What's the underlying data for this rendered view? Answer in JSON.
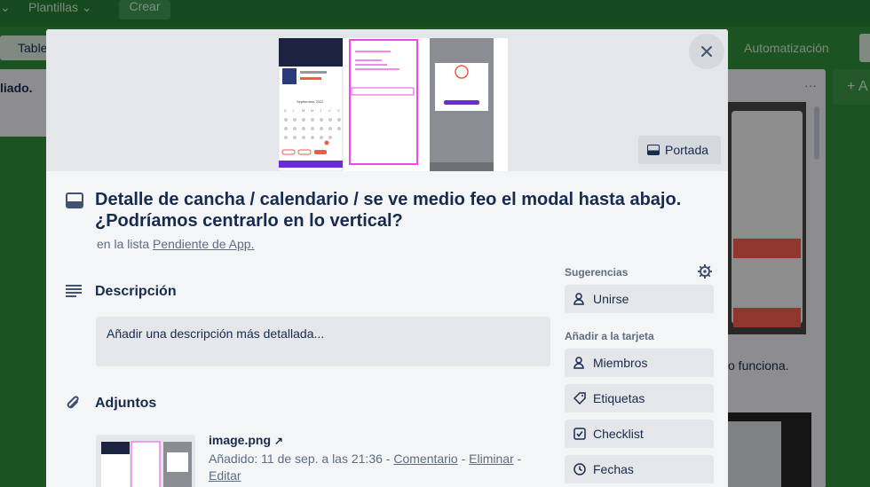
{
  "board": {
    "menu_partial": "⌄",
    "menu_templates": "Plantillas",
    "create_label": "Crear",
    "view_table": "Table",
    "automation_label": "Automatización",
    "left_list_partial": "liado.",
    "right_card_text": "o funciona.",
    "add_list_partial": "+ A",
    "list_menu": "···"
  },
  "modal": {
    "cover_button": "Portada",
    "title": "Detalle de cancha / calendario / se ve medio feo el modal hasta abajo. ¿Podríamos centrarlo en lo vertical?",
    "in_list_prefix": "en la lista",
    "list_name": "Pendiente de App.",
    "description_heading": "Descripción",
    "description_placeholder": "Añadir una descripción más detallada...",
    "attachments_heading": "Adjuntos",
    "attachment": {
      "name": "image.png",
      "added": "Añadido: 11 de sep. a las 21:36",
      "sep": "-",
      "comment": "Comentario",
      "delete": "Eliminar",
      "edit": "Editar"
    },
    "cover_mock": {
      "month": "Septiembre 2022",
      "weekdays": [
        "D",
        "L",
        "M",
        "M",
        "J",
        "V",
        "S"
      ]
    }
  },
  "sidebar": {
    "suggestions_heading": "Sugerencias",
    "join": "Unirse",
    "add_to_card_heading": "Añadir a la tarjeta",
    "members": "Miembros",
    "labels": "Etiquetas",
    "checklist": "Checklist",
    "dates": "Fechas"
  },
  "colors": {
    "board_bg": "#2f8a3a",
    "modal_bg": "#f4f5f7",
    "button_bg": "#e4e6ea",
    "text": "#172b4d",
    "muted": "#5e6c84"
  }
}
